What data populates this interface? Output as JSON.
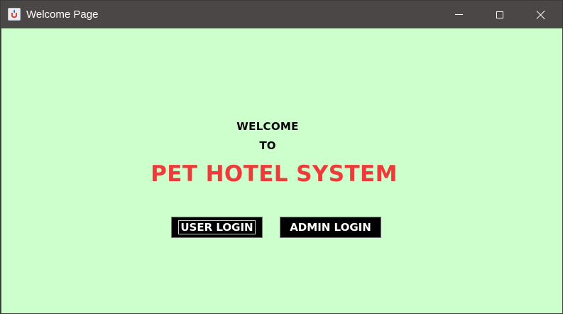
{
  "window": {
    "title": "Welcome Page",
    "app_icon": "java-cup-icon",
    "controls": {
      "minimize_icon": "minimize-icon",
      "maximize_icon": "maximize-icon",
      "close_icon": "close-icon"
    }
  },
  "main": {
    "welcome_text": "WELCOME",
    "to_text": "TO",
    "system_title": "PET HOTEL SYSTEM",
    "user_login_label": "USER LOGIN",
    "admin_login_label": "ADMIN LOGIN"
  },
  "colors": {
    "background": "#ccffcc",
    "title_accent": "#f03a3a",
    "button_bg": "#000000",
    "button_text": "#ffffff",
    "titlebar": "#4a4746"
  }
}
